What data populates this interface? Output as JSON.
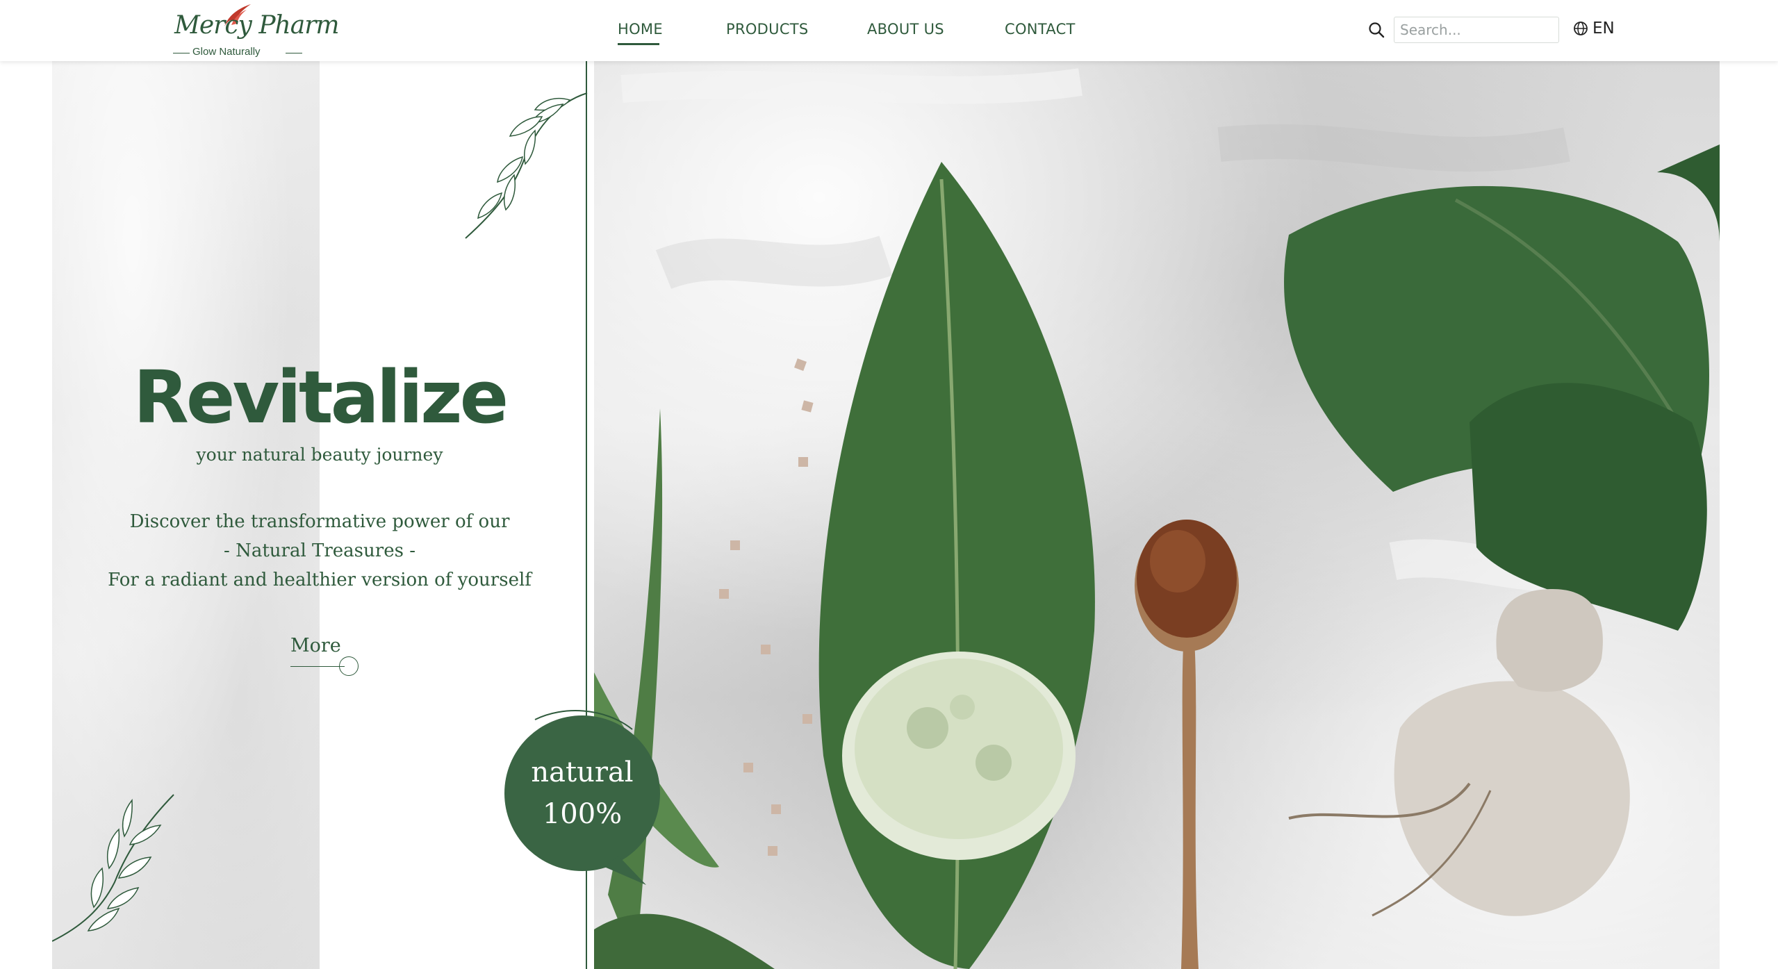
{
  "brand": {
    "name": "Mercy Pharm",
    "tagline": "Glow Naturally",
    "accent": "#2f5a3c",
    "logo_accent": "#c0392b"
  },
  "nav": {
    "items": [
      {
        "label": "HOME",
        "active": true
      },
      {
        "label": "PRODUCTS",
        "active": false
      },
      {
        "label": "ABOUT US",
        "active": false
      },
      {
        "label": "CONTACT",
        "active": false
      }
    ]
  },
  "search": {
    "placeholder": "Search...",
    "value": "",
    "icon": "search-icon"
  },
  "language": {
    "label": "EN",
    "icon": "globe-icon"
  },
  "hero": {
    "title": "Revitalize",
    "subtitle": "your natural beauty journey",
    "description": [
      "Discover the transformative power of our",
      "- Natural Treasures -",
      "For a radiant and healthier version of yourself"
    ],
    "more_label": "More",
    "badge": {
      "line1": "natural",
      "line2": "100%"
    }
  }
}
